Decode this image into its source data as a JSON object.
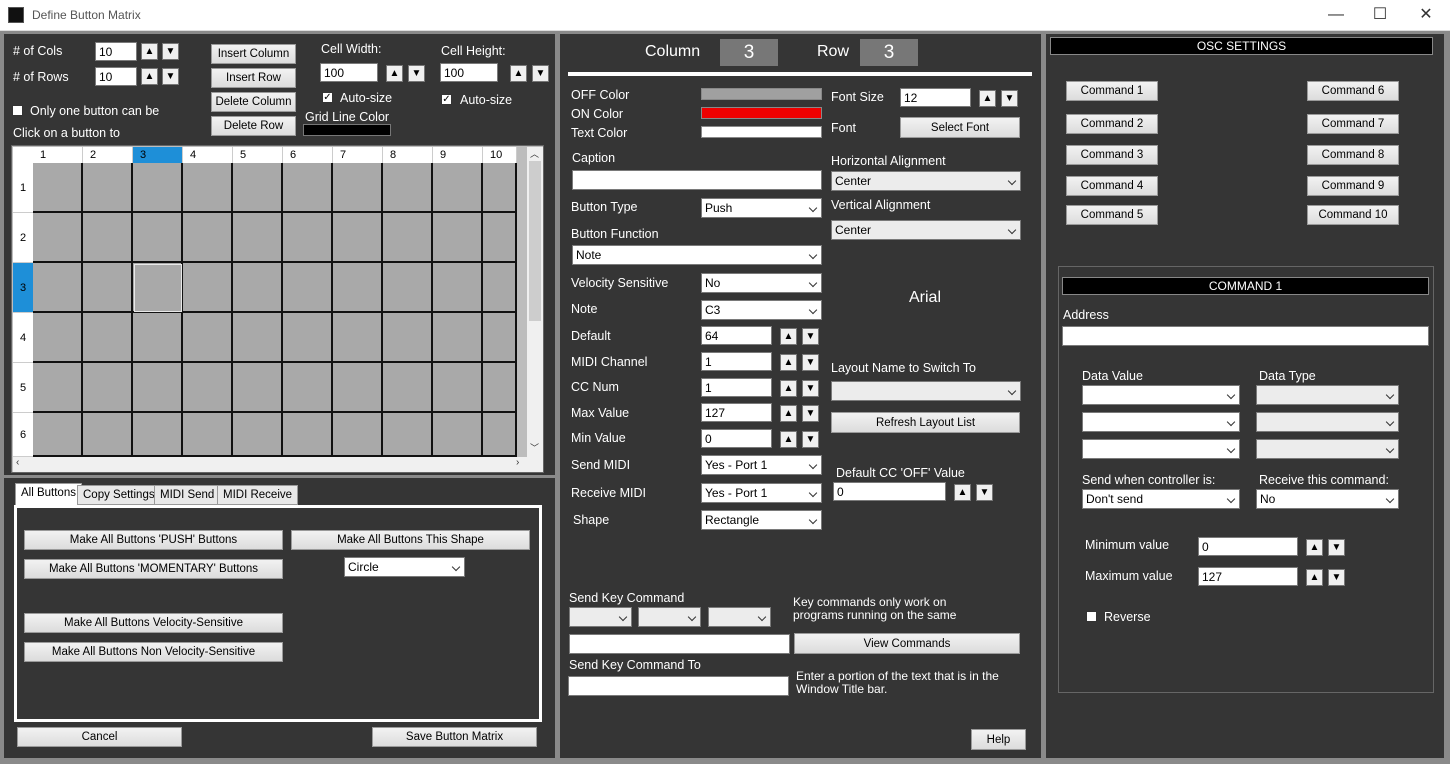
{
  "window": {
    "title": "Define Button Matrix",
    "minimize": "—",
    "maximize": "☐",
    "close": "✕"
  },
  "matrix": {
    "cols_label": "# of Cols",
    "cols_value": "10",
    "rows_label": "# of Rows",
    "rows_value": "10",
    "insert_column": "Insert Column",
    "insert_row": "Insert Row",
    "delete_column": "Delete Column",
    "delete_row": "Delete Row",
    "cell_width_label": "Cell Width:",
    "cell_width_value": "100",
    "cell_height_label": "Cell Height:",
    "cell_height_value": "100",
    "autosize_label": "Auto-size",
    "grid_line_color_label": "Grid Line Color",
    "only_one_label": "Only one button can be",
    "click_label": "Click on a button to",
    "column_headers": [
      "1",
      "2",
      "3",
      "4",
      "5",
      "6",
      "7",
      "8",
      "9",
      "10"
    ],
    "row_headers": [
      "1",
      "2",
      "3",
      "4",
      "5",
      "6"
    ],
    "selected_column": "3",
    "selected_row": "3"
  },
  "tabs": [
    "All Buttons",
    "Copy Settings",
    "MIDI Send",
    "MIDI Receive"
  ],
  "all_buttons": {
    "make_push": "Make All Buttons 'PUSH' Buttons",
    "make_momentary": "Make All Buttons 'MOMENTARY' Buttons",
    "make_shape": "Make All Buttons This Shape",
    "shape_value": "Circle",
    "make_velocity": "Make All Buttons Velocity-Sensitive",
    "make_non_velocity": "Make All Buttons Non Velocity-Sensitive"
  },
  "footer": {
    "cancel": "Cancel",
    "save": "Save Button Matrix"
  },
  "button_props": {
    "column_label": "Column",
    "column_value": "3",
    "row_label": "Row",
    "row_value": "3",
    "off_color_label": "OFF Color",
    "on_color_label": "ON Color",
    "text_color_label": "Text Color",
    "off_color": "#a0a0a0",
    "on_color": "#ee0000",
    "text_color": "#ffffff",
    "caption_label": "Caption",
    "caption_value": "",
    "button_type_label": "Button Type",
    "button_type_value": "Push",
    "button_function_label": "Button Function",
    "button_function_value": "Note",
    "velocity_label": "Velocity Sensitive",
    "velocity_value": "No",
    "note_label": "Note",
    "note_value": "C3",
    "default_label": "Default",
    "default_value": "64",
    "midi_channel_label": "MIDI Channel",
    "midi_channel_value": "1",
    "cc_num_label": "CC Num",
    "cc_num_value": "1",
    "max_label": "Max Value",
    "max_value": "127",
    "min_label": "Min Value",
    "min_value": "0",
    "send_midi_label": "Send MIDI",
    "send_midi_value": "Yes - Port 1",
    "receive_midi_label": "Receive MIDI",
    "receive_midi_value": "Yes - Port 1",
    "shape_label": "Shape",
    "shape_value": "Rectangle",
    "font_size_label": "Font Size",
    "font_size_value": "12",
    "font_label": "Font",
    "select_font": "Select Font",
    "h_align_label": "Horizontal Alignment",
    "h_align_value": "Center",
    "v_align_label": "Vertical Alignment",
    "v_align_value": "Center",
    "font_preview": "Arial",
    "layout_switch_label": "Layout Name to Switch To",
    "layout_switch_value": "",
    "refresh_layout": "Refresh Layout List",
    "default_cc_off_label": "Default CC 'OFF' Value",
    "default_cc_off_value": "0",
    "send_key_label": "Send Key Command",
    "key_note": "Key commands only work on programs running on the same",
    "view_commands": "View Commands",
    "send_key_to_label": "Send Key Command To",
    "send_key_to_note": "Enter a portion of the text that is in the Window Title bar.",
    "help": "Help"
  },
  "osc": {
    "header": "OSC SETTINGS",
    "commands_left": [
      "Command 1",
      "Command 2",
      "Command 3",
      "Command 4",
      "Command 5"
    ],
    "commands_right": [
      "Command 6",
      "Command 7",
      "Command 8",
      "Command 9",
      "Command 10"
    ],
    "command_header": "COMMAND 1",
    "address_label": "Address",
    "address_value": "",
    "data_value_label": "Data Value",
    "data_type_label": "Data Type",
    "send_when_label": "Send when controller is:",
    "send_when_value": "Don't send",
    "receive_cmd_label": "Receive this command:",
    "receive_cmd_value": "No",
    "min_label": "Minimum value",
    "min_value": "0",
    "max_label": "Maximum value",
    "max_value": "127",
    "reverse_label": "Reverse"
  }
}
